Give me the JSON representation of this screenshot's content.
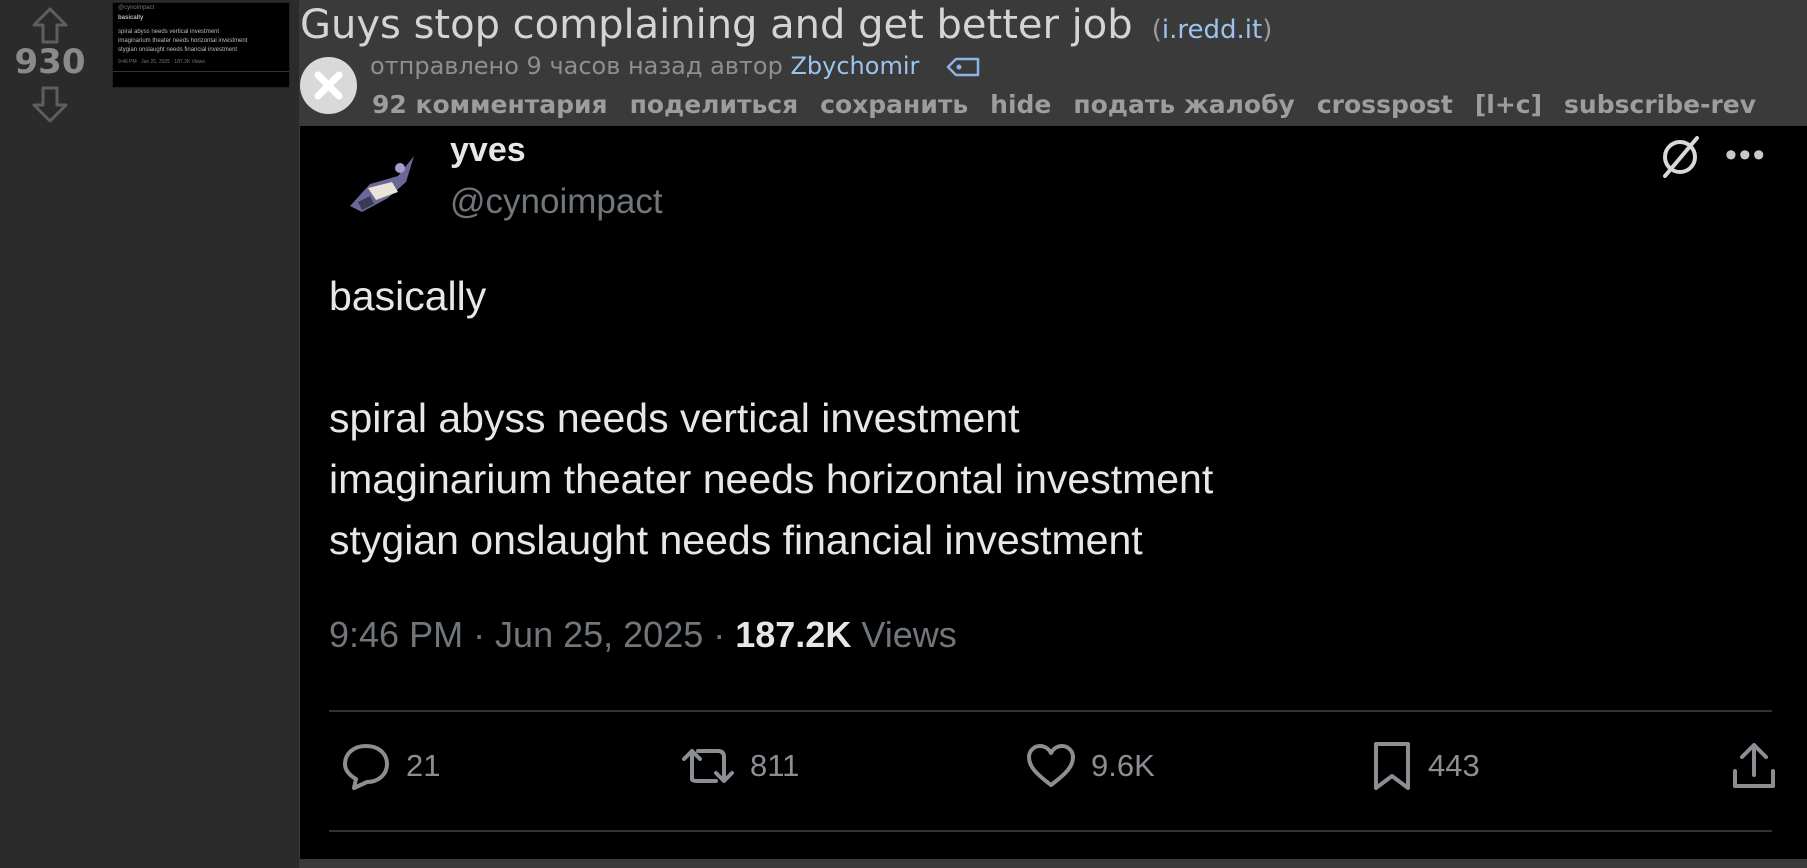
{
  "post": {
    "score": "930",
    "title": "Guys stop complaining and get better job",
    "domain_open": "(",
    "domain": "i.redd.it",
    "domain_close": ")",
    "submitted_prefix": "отправлено 9 часов назад автор",
    "author": "Zbychomir",
    "buttons": {
      "comments": "92 комментария",
      "share": "поделиться",
      "save": "сохранить",
      "hide": "hide",
      "report": "подать жалобу",
      "crosspost": "crosspost",
      "lc": "[l+c]",
      "subscribe": "subscribe-rev"
    }
  },
  "thumbnail": {
    "handle": "@cynoimpact",
    "lines": [
      "basically",
      "spiral abyss needs vertical investment",
      "imaginarium theater needs horizontal investment",
      "stygian onslaught needs financial investment"
    ],
    "meta": "9:46 PM · Jun 25, 2025 · 187.2K Views"
  },
  "tweet": {
    "name": "yves",
    "handle": "@cynoimpact",
    "text": [
      "basically",
      "",
      "spiral abyss needs vertical investment",
      "imaginarium theater needs horizontal investment",
      "stygian onslaught needs financial investment"
    ],
    "time": "9:46 PM · Jun 25, 2025 · ",
    "views_count": "187.2K",
    "views_label": " Views",
    "replies": "21",
    "retweets": "811",
    "likes": "9.6K",
    "bookmarks": "443"
  },
  "colors": {
    "background": "#3a3a3a",
    "sidebar": "#2b2b2b",
    "link": "#9cc3ee",
    "tweet_bg": "#000000"
  }
}
